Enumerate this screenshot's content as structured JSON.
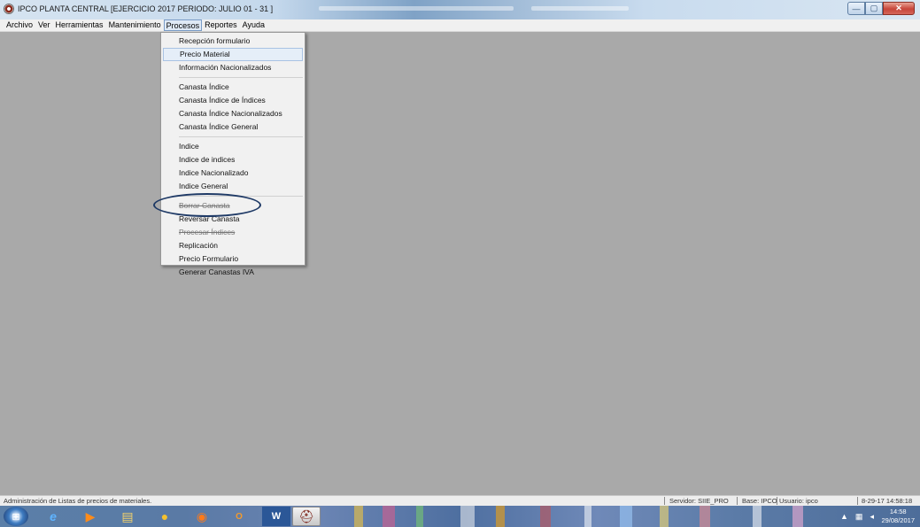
{
  "window": {
    "title": "IPCO PLANTA CENTRAL [EJERCICIO 2017 PERIODO: JULIO 01 - 31 ]",
    "controls": {
      "minimize": "—",
      "maximize": "▢",
      "close": "✕"
    }
  },
  "menubar": {
    "items": [
      "Archivo",
      "Ver",
      "Herramientas",
      "Mantenimiento",
      "Procesos",
      "Reportes",
      "Ayuda"
    ],
    "active": "Procesos"
  },
  "procesos_menu": {
    "groups": [
      [
        "Recepción formulario",
        "Precio Material",
        "Información Nacionalizados"
      ],
      [
        "Canasta Índice",
        "Canasta Índice de Índices",
        "Canasta Índice Nacionalizados",
        "Canasta Índice General"
      ],
      [
        "Indice",
        "Indice de indices",
        "Indice Nacionalizado",
        "Indice General"
      ],
      [
        "Borrar Canasta",
        "Reversar Canasta",
        "Procesar Índices",
        "Replicación",
        "Precio Formulario",
        "Generar Canastas IVA"
      ]
    ],
    "highlighted": "Precio Material",
    "circled": "Reversar Canasta"
  },
  "statusbar": {
    "message": "Administración de Listas de precios de materiales.",
    "server": "Servidor: SIIE_PRO",
    "base": "Base: IPCO",
    "user": "Usuario: ipco",
    "datetime": "8-29-17 14:58:18"
  },
  "taskbar": {
    "apps": [
      "internet-explorer",
      "media-player",
      "file-explorer",
      "chrome",
      "firefox",
      "outlook",
      "word",
      "ipco-app"
    ],
    "clock_time": "14:58",
    "clock_date": "29/08/2017"
  }
}
